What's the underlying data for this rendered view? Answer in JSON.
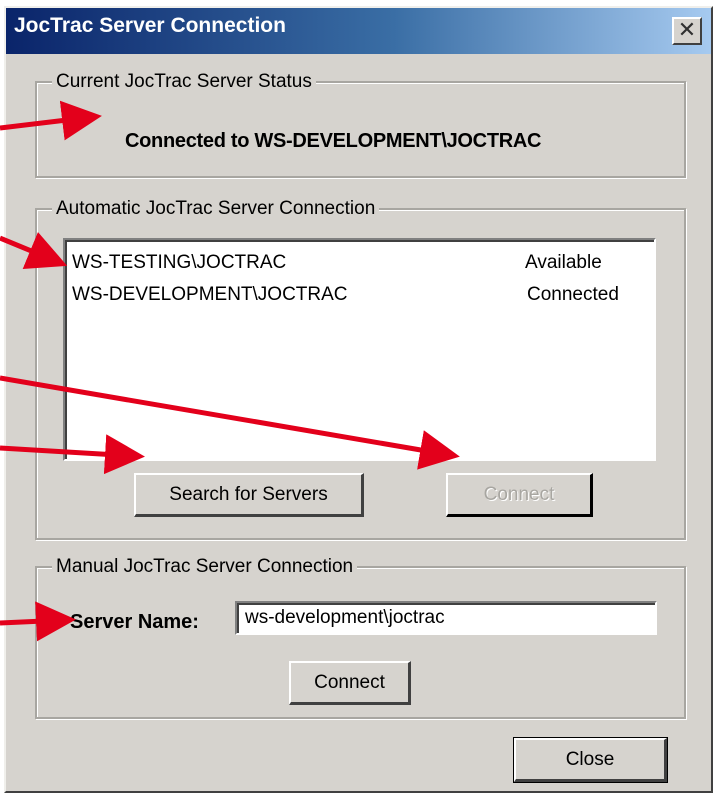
{
  "window": {
    "title": "JocTrac Server Connection",
    "close_glyph": "✕",
    "colors": {
      "titlebar_start": "#0a246a",
      "titlebar_end": "#a6caf0",
      "face": "#d6d3ce",
      "annotation_arrow": "#e3001b"
    }
  },
  "status_group": {
    "label": "Current JocTrac Server Status",
    "status_text": "Connected to WS-DEVELOPMENT\\JOCTRAC"
  },
  "auto_group": {
    "label": "Automatic JocTrac Server Connection",
    "servers": [
      {
        "name": "WS-TESTING\\JOCTRAC",
        "status": "Available"
      },
      {
        "name": "WS-DEVELOPMENT\\JOCTRAC",
        "status": "Connected"
      }
    ],
    "search_button": "Search for Servers",
    "connect_button": "Connect"
  },
  "manual_group": {
    "label": "Manual JocTrac Server Connection",
    "server_name_label": "Server Name:",
    "server_name_value": "ws-development\\joctrac",
    "connect_button": "Connect"
  },
  "footer": {
    "close_button": "Close"
  },
  "annotations": {
    "arrow_count": 5,
    "arrow_icon": "red-annotation-arrow"
  }
}
